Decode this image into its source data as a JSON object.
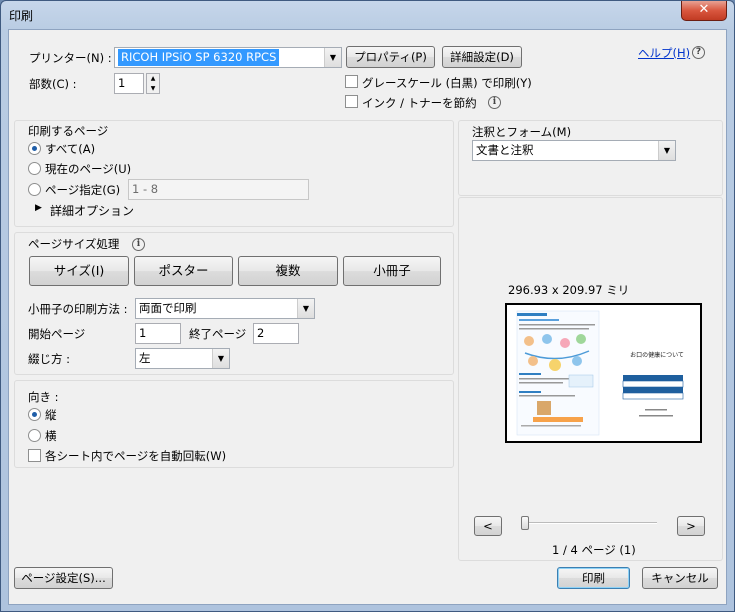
{
  "window": {
    "title": "印刷",
    "close_glyph": "✕"
  },
  "printer": {
    "label": "プリンター(N) :",
    "selected": "RICOH IPSiO SP 6320 RPCS",
    "properties_button": "プロパティ(P)",
    "advanced_button": "詳細設定(D)",
    "help_link": "ヘルプ(H)",
    "copies_label": "部数(C) :",
    "copies_value": "1",
    "grayscale_label": "グレースケール (白黒) で印刷(Y)",
    "grayscale_checked": false,
    "save_ink_label": "インク / トナーを節約",
    "save_ink_checked": false
  },
  "pages": {
    "heading": "印刷するページ",
    "all_label": "すべて(A)",
    "current_label": "現在のページ(U)",
    "range_label": "ページ指定(G)",
    "range_value": "1 - 8",
    "selected": "all",
    "more_options": "詳細オプション"
  },
  "sizing": {
    "heading": "ページサイズ処理",
    "buttons": [
      "サイズ(I)",
      "ポスター",
      "複数",
      "小冊子"
    ],
    "booklet_subset_label": "小冊子の印刷方法 :",
    "booklet_subset_value": "両面で印刷",
    "start_page_label": "開始ページ",
    "start_page_value": "1",
    "end_page_label": "終了ページ",
    "end_page_value": "2",
    "binding_label": "綴じ方 :",
    "binding_value": "左"
  },
  "orientation": {
    "heading": "向き :",
    "portrait_label": "縦",
    "landscape_label": "横",
    "selected": "portrait",
    "auto_rotate_label": "各シート内でページを自動回転(W)",
    "auto_rotate_checked": false
  },
  "comments": {
    "heading": "注釈とフォーム(M)",
    "value": "文書と注釈"
  },
  "preview": {
    "dimensions": "296.93 x 209.97 ミリ",
    "page_indicator": "1 / 4 ページ (1)",
    "prev_glyph": "<",
    "next_glyph": ">",
    "thumb_title": "お口の健康について"
  },
  "footer": {
    "page_setup_button": "ページ設定(S)...",
    "print_button": "印刷",
    "cancel_button": "キャンセル"
  }
}
